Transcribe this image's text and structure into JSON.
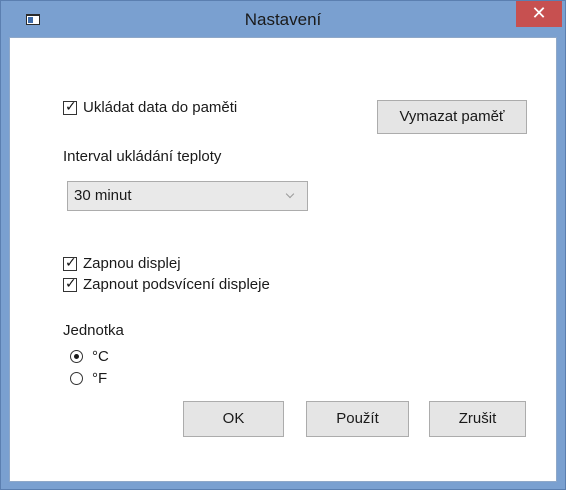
{
  "window": {
    "title": "Nastavení",
    "close_glyph": "✕",
    "app_icon": "window-app-icon"
  },
  "memory": {
    "store_checkbox_label": "Ukládat data do paměti",
    "store_checked": true,
    "clear_button_label": "Vymazat paměť"
  },
  "interval": {
    "label": "Interval ukládání teploty",
    "selected": "30 minut"
  },
  "display": {
    "enable_label": "Zapnou displej",
    "enable_checked": true,
    "backlight_label": "Zapnout podsvícení displeje",
    "backlight_checked": true
  },
  "unit": {
    "label": "Jednotka",
    "options": [
      {
        "label": "°C",
        "selected": true
      },
      {
        "label": "°F",
        "selected": false
      }
    ]
  },
  "buttons": {
    "ok": "OK",
    "apply": "Použít",
    "cancel": "Zrušit"
  },
  "colors": {
    "frame": "#7aa0d0",
    "close_button": "#c75050",
    "button_face": "#e5e5e5"
  }
}
